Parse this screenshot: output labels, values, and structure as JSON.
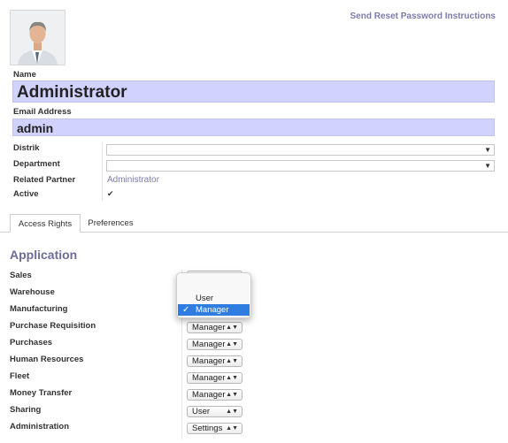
{
  "header": {
    "reset_link": "Send Reset Password Instructions"
  },
  "user": {
    "name_label": "Name",
    "name": "Administrator",
    "email_label": "Email Address",
    "email": "admin"
  },
  "details": {
    "distrik_label": "Distrik",
    "distrik_value": "",
    "department_label": "Department",
    "department_value": "",
    "related_partner_label": "Related Partner",
    "related_partner": "Administrator",
    "active_label": "Active",
    "active_checked": true
  },
  "tabs": [
    {
      "label": "Access Rights",
      "active": true
    },
    {
      "label": "Preferences",
      "active": false
    }
  ],
  "section_title": "Application",
  "applications": [
    {
      "label": "Sales",
      "value": ""
    },
    {
      "label": "Warehouse",
      "value": ""
    },
    {
      "label": "Manufacturing",
      "value": ""
    },
    {
      "label": "Purchase Requisition",
      "value": "Manager"
    },
    {
      "label": "Purchases",
      "value": "Manager"
    },
    {
      "label": "Human Resources",
      "value": "Manager"
    },
    {
      "label": "Fleet",
      "value": "Manager"
    },
    {
      "label": "Money Transfer",
      "value": "Manager"
    },
    {
      "label": "Sharing",
      "value": "User"
    },
    {
      "label": "Administration",
      "value": "Settings"
    }
  ],
  "popup": {
    "options": [
      "",
      "User",
      "Manager"
    ],
    "selected": "Manager",
    "check_glyph": "✓"
  },
  "glyphs": {
    "dropdown": "▼",
    "updown": "▲▼",
    "checkbox": "✔"
  },
  "colors": {
    "accent": "#7c7bad",
    "input_bg": "#d2d2ff",
    "selected_bg": "#2f7de0"
  }
}
